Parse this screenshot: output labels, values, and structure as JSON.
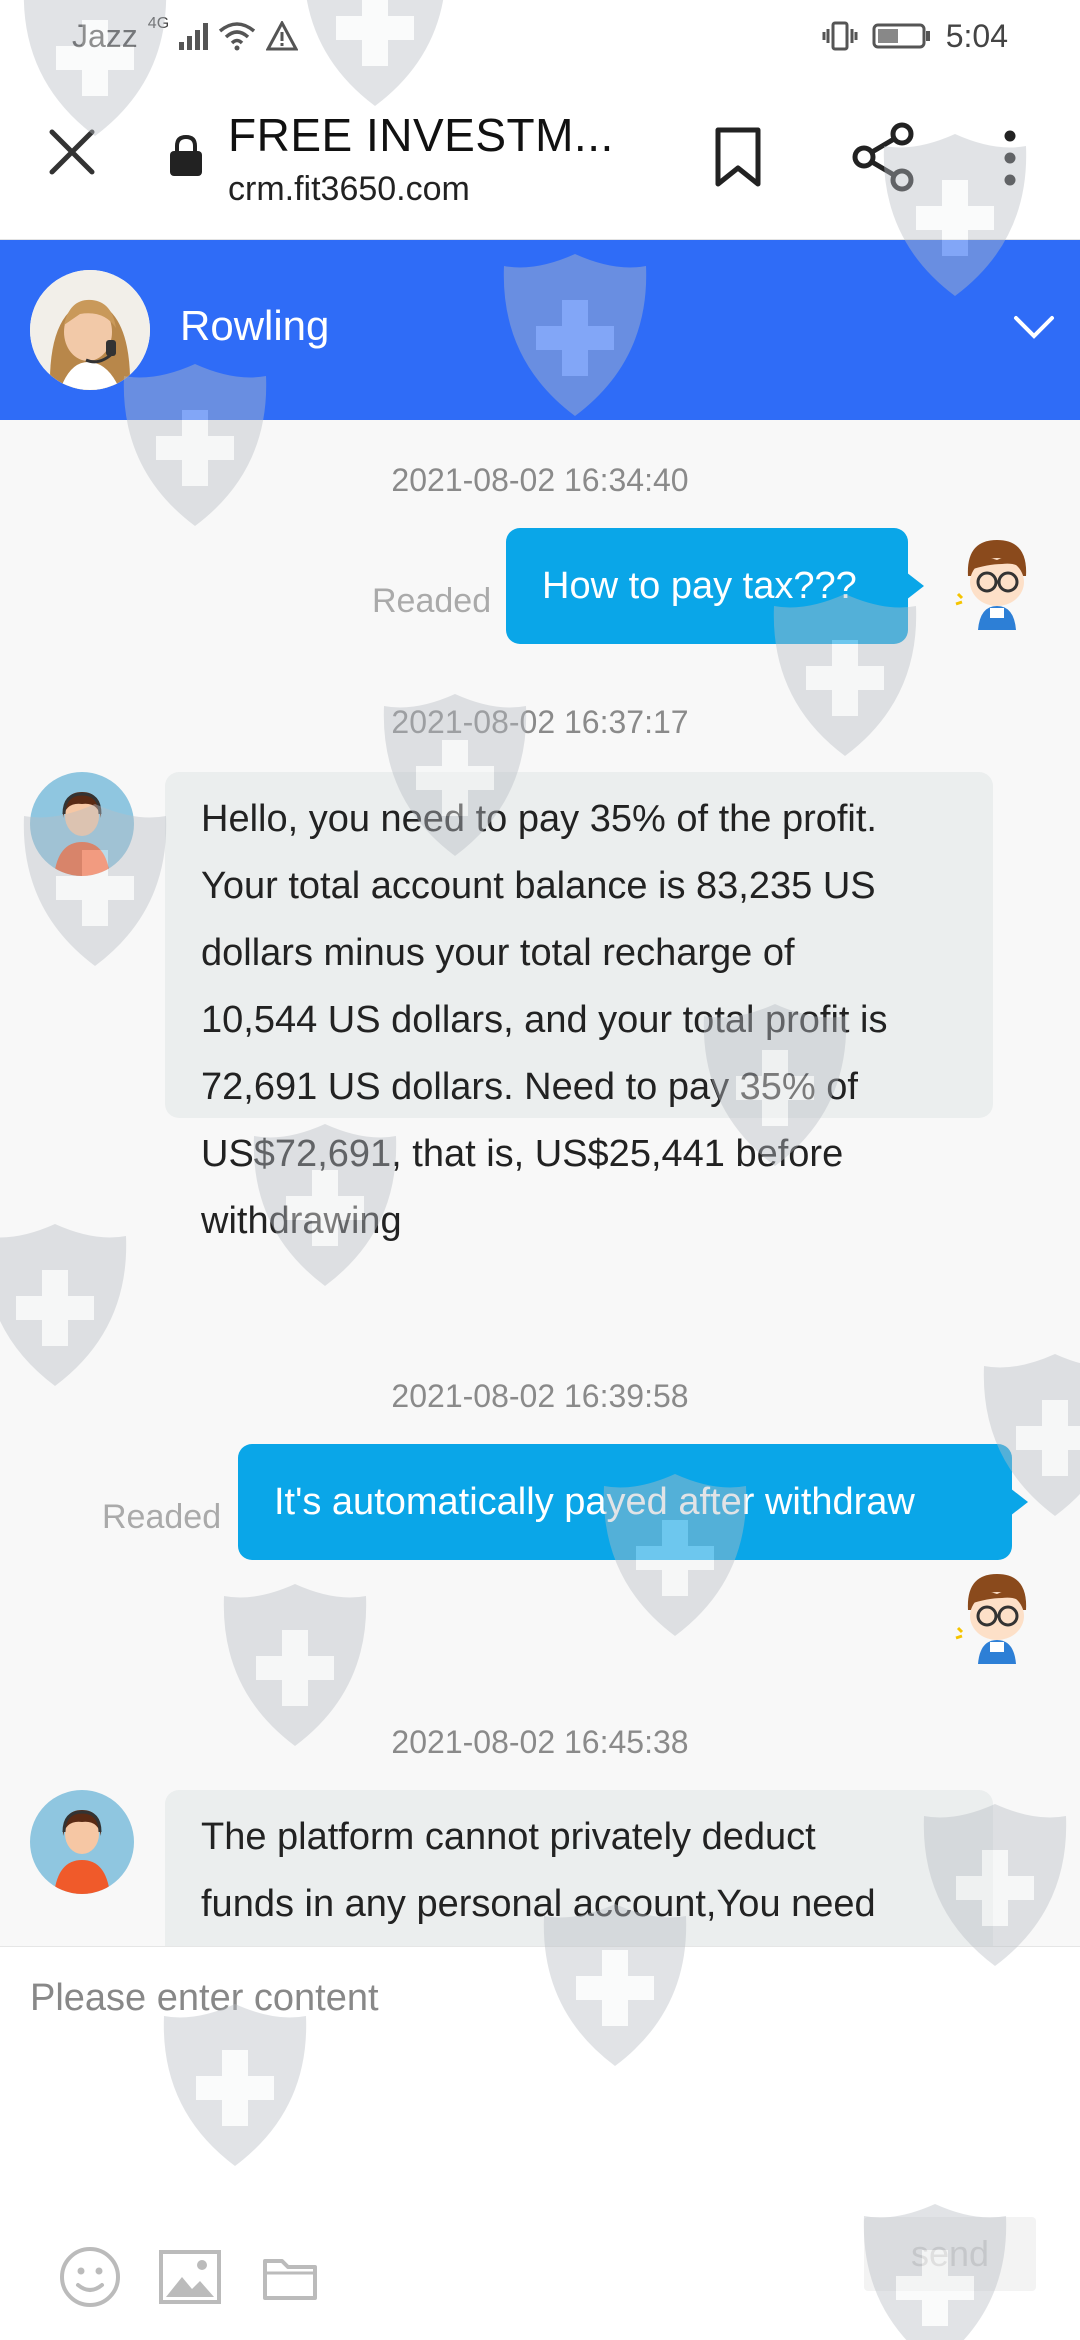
{
  "status_bar": {
    "carrier": "Jazz",
    "network": "4G",
    "time": "5:04"
  },
  "browser": {
    "title": "FREE INVESTM...",
    "url": "crm.fit3650.com",
    "icons": [
      "close-icon",
      "lock-icon",
      "bookmark-icon",
      "share-icon",
      "more-vert-icon"
    ]
  },
  "chat_header": {
    "agent_name": "Rowling",
    "icons": [
      "agent-avatar",
      "chevron-down-icon"
    ]
  },
  "messages": [
    {
      "type": "timestamp",
      "text": "2021-08-02 16:34:40"
    },
    {
      "type": "outgoing",
      "text": "How to pay tax???",
      "status": "Readed"
    },
    {
      "type": "timestamp",
      "text": "2021-08-02 16:37:17"
    },
    {
      "type": "incoming",
      "lines": [
        "Hello, you need to pay 35% of the profit.",
        "Your total account balance is 83,235 US",
        "dollars minus your total recharge of",
        "10,544 US dollars, and your total profit is",
        "72,691 US dollars. Need to pay 35% of",
        "US$72,691, that is, US$25,441 before",
        "withdrawing"
      ]
    },
    {
      "type": "timestamp",
      "text": "2021-08-02 16:39:58"
    },
    {
      "type": "outgoing",
      "text": "It's automatically payed after withdraw",
      "status": "Readed"
    },
    {
      "type": "timestamp",
      "text": "2021-08-02 16:45:38"
    },
    {
      "type": "incoming",
      "lines": [
        "The platform cannot privately deduct",
        "funds in any personal account,You need"
      ]
    }
  ],
  "input": {
    "placeholder": "Please enter content",
    "send_label": "send",
    "tools": [
      "emoji-icon",
      "image-icon",
      "folder-icon"
    ]
  },
  "colors": {
    "header_blue": "#2f6cf7",
    "outgoing_bubble": "#0aa6e8",
    "incoming_bubble": "#ebeeee"
  }
}
